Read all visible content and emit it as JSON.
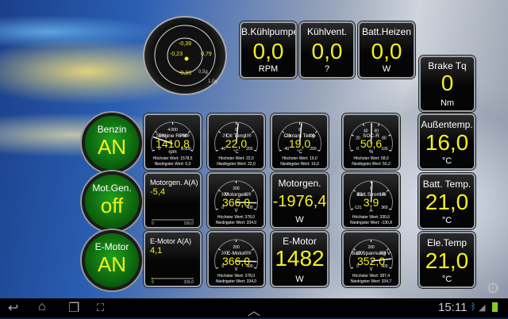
{
  "gmeter": {
    "top": "-0,39",
    "left": "-0,23",
    "right": "0,79",
    "bottom": "-0,33",
    "ring1": "0,5g",
    "ring2": "1,0g"
  },
  "top_tiles": [
    {
      "label": "B.Kühlpumpe",
      "value": "0,0",
      "unit": "RPM"
    },
    {
      "label": "Kühlvent.",
      "value": "0,0",
      "unit": "?"
    },
    {
      "label": "Batt.Heizen",
      "value": "0,0",
      "unit": "W"
    },
    {
      "label": "Brake Tq",
      "value": "0",
      "unit": "Nm"
    }
  ],
  "round_buttons": [
    {
      "label": "Benzin",
      "value": "AN"
    },
    {
      "label": "Mot.Gen.",
      "value": "off"
    },
    {
      "label": "E-Motor",
      "value": "AN"
    }
  ],
  "gauges": [
    {
      "title": "Engine RPM",
      "value": "1410,8",
      "unit": "rpm",
      "ticks": [
        "0",
        "2.000",
        "4.000",
        "6.000",
        "8.000"
      ],
      "min": 0,
      "max": 8000,
      "reading": 1410.8,
      "high": "Höchster Wert: 1578,5",
      "low": "Niedrigster Wert: 0,0"
    },
    {
      "title": "Oil Temp",
      "value": "22,0",
      "unit": "°C",
      "ticks": [
        "-40",
        "-20",
        "0",
        "100",
        "200"
      ],
      "min": 0,
      "max": 4,
      "reading": 2.1,
      "high": "Höchster Wert: 22,0",
      "low": "Niedrigster Wert: 22,0"
    },
    {
      "title": "Coolant Temp",
      "value": "19,0",
      "unit": "°C",
      "ticks": [
        "-40",
        "-20",
        "0",
        "100",
        "200"
      ],
      "min": 0,
      "max": 4,
      "reading": 2.1,
      "high": "Höchster Wert: 19,0",
      "low": "Niedrigster Wert: 19,0"
    },
    {
      "title": "SOC-R",
      "value": "50,6",
      "unit": "%",
      "ticks": [
        "0",
        "20",
        "40",
        "60",
        "80",
        "100"
      ],
      "min": 0,
      "max": 100,
      "reading": 50.6,
      "high": "Höchster Wert: 58,0",
      "low": "Niedrigster Wert: 50,2"
    },
    {
      "title": "Motorgen.",
      "value": "366,0",
      "unit": "V",
      "ticks": [
        "0",
        "100",
        "200",
        "300",
        "400"
      ],
      "min": 0,
      "max": 400,
      "reading": 366,
      "high": "Höchster Wert: 378,0",
      "low": "Niedrigster Wert: 334,0"
    },
    {
      "title": "Batt.Strom A",
      "value": "3,9",
      "unit": "A",
      "ticks": [
        "-131",
        "-65",
        "0",
        "180",
        "360"
      ],
      "min": 0,
      "max": 4,
      "reading": 2.05,
      "high": "Höchster Wert: 330,6",
      "low": "Niedrigster Wert: -130,8"
    },
    {
      "title": "E-Motor",
      "value": "366,0",
      "unit": "V",
      "ticks": [
        "0",
        "100",
        "200",
        "300",
        "400"
      ],
      "min": 0,
      "max": 400,
      "reading": 366,
      "high": "Höchster Wert: 378,0",
      "low": "Niedrigster Wert: 334,0"
    },
    {
      "title": "Batt.Spannung V",
      "value": "352,0",
      "unit": "V",
      "ticks": [
        "0",
        "100",
        "200",
        "300",
        "400"
      ],
      "min": 0,
      "max": 400,
      "reading": 352,
      "high": "Höchster Wert: 387,4",
      "low": "Niedrigster Wert: 334,7"
    }
  ],
  "bar_tiles": [
    {
      "label": "Motorgen. A(A)",
      "value": "-5,4",
      "min": "0",
      "max": "100,0",
      "fraction": 0
    },
    {
      "label": "E-Motor A(A)",
      "value": "4,1",
      "min": "0",
      "max": "339,0",
      "fraction": 0.01
    }
  ],
  "big_tiles": [
    {
      "label": "Motorgen.",
      "value": "-1976,4",
      "unit": "W"
    },
    {
      "label": "E-Motor",
      "value": "1482",
      "unit": "W"
    }
  ],
  "right_tiles": [
    {
      "label": "Außentemp.",
      "value": "16,0",
      "unit": "°C"
    },
    {
      "label": "Batt. Temp.",
      "value": "21,0",
      "unit": "°C"
    },
    {
      "label": "Ele.Temp",
      "value": "21,0",
      "unit": "°C"
    }
  ],
  "status": {
    "time": "15:11"
  }
}
